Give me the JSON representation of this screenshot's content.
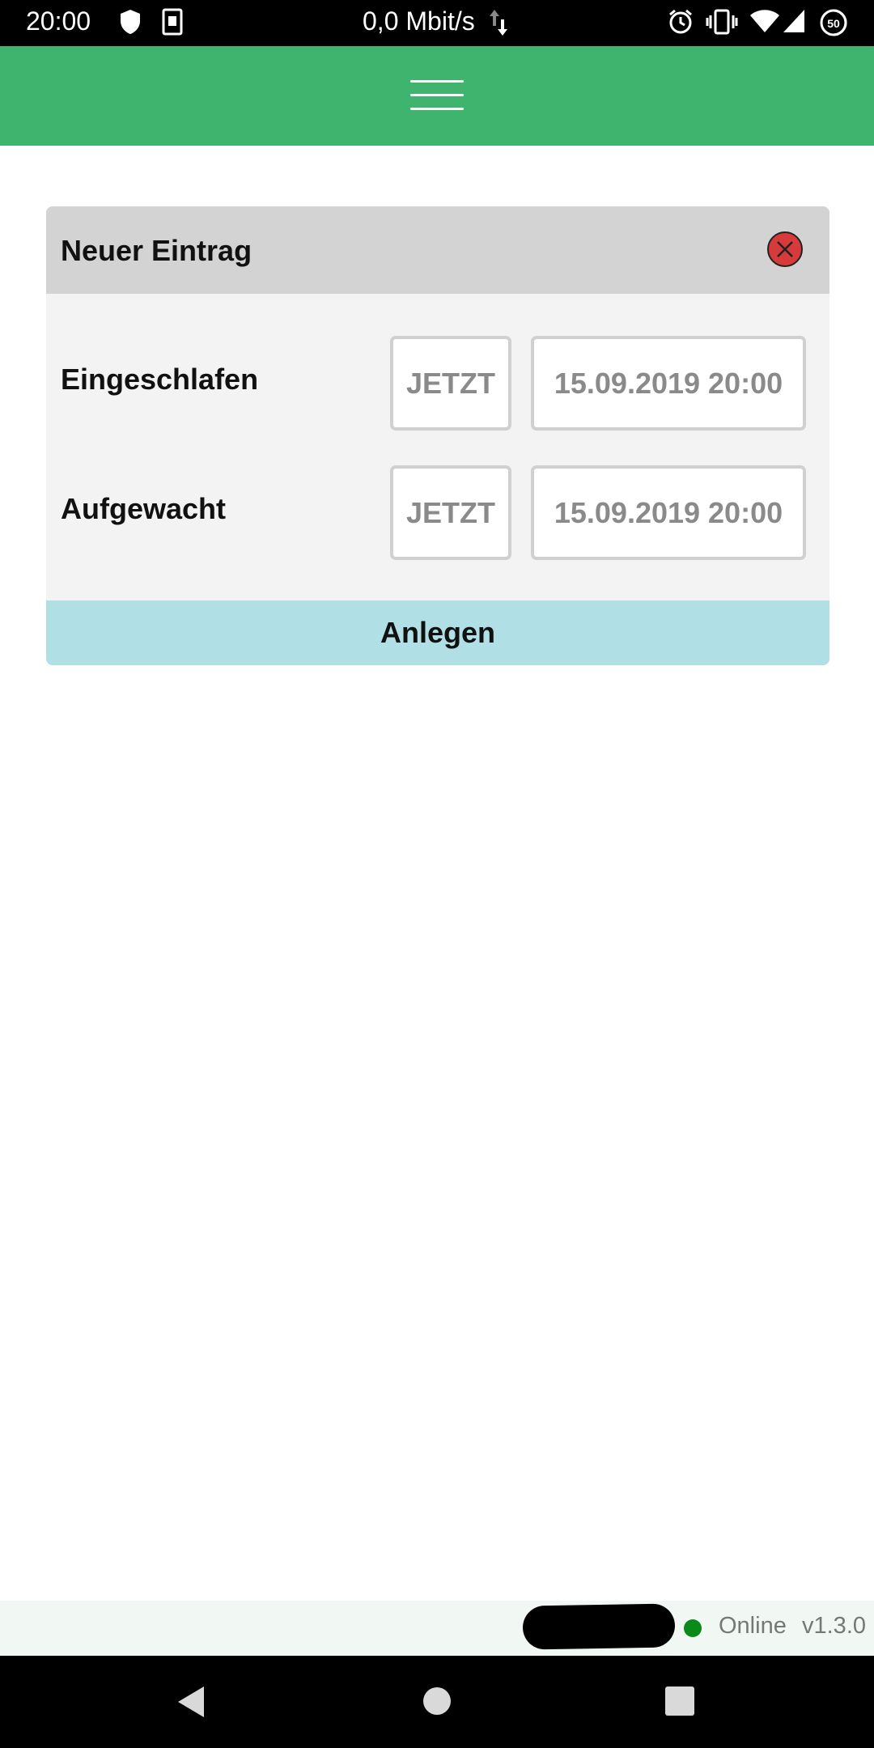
{
  "status_bar": {
    "time": "20:00",
    "network_speed": "0,0 Mbit/s",
    "battery_level": "50",
    "icons": [
      "shield-icon",
      "sim-card-icon",
      "data-arrows-icon",
      "alarm-icon",
      "vibrate-icon",
      "wifi-icon",
      "signal-icon",
      "battery-icon"
    ]
  },
  "app_bar": {
    "menu_icon": "hamburger-menu-icon",
    "color": "#3eb46e"
  },
  "entry_card": {
    "title": "Neuer Eintrag",
    "close_icon": "close-circle-icon",
    "rows": [
      {
        "label": "Eingeschlafen",
        "now_label": "JETZT",
        "datetime": "15.09.2019 20:00"
      },
      {
        "label": "Aufgewacht",
        "now_label": "JETZT",
        "datetime": "15.09.2019 20:00"
      }
    ],
    "submit_label": "Anlegen",
    "submit_color": "#b0dfe5",
    "close_color": "#d73a3a"
  },
  "footer": {
    "status_text": "Online",
    "status_color": "#0a8a1a",
    "version": "v1.3.0"
  },
  "nav_bar": {
    "icons": [
      "back-icon",
      "home-icon",
      "recents-icon"
    ]
  }
}
